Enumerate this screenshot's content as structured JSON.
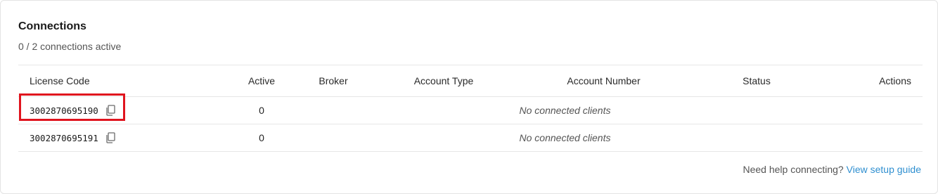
{
  "connections": {
    "title": "Connections",
    "subtitle": "0 / 2 connections active"
  },
  "table": {
    "headers": {
      "license_code": "License Code",
      "active": "Active",
      "broker": "Broker",
      "account_type": "Account Type",
      "account_number": "Account Number",
      "status": "Status",
      "actions": "Actions"
    },
    "rows": [
      {
        "license_code": "3002870695190",
        "active": "0",
        "empty_message": "No connected clients",
        "copy_icon": "copy-icon"
      },
      {
        "license_code": "3002870695191",
        "active": "0",
        "empty_message": "No connected clients",
        "copy_icon": "copy-icon"
      }
    ]
  },
  "help": {
    "text": "Need help connecting?",
    "link_text": "View setup guide"
  },
  "colors": {
    "highlight": "#e0141e",
    "link": "#2f8fd0"
  }
}
